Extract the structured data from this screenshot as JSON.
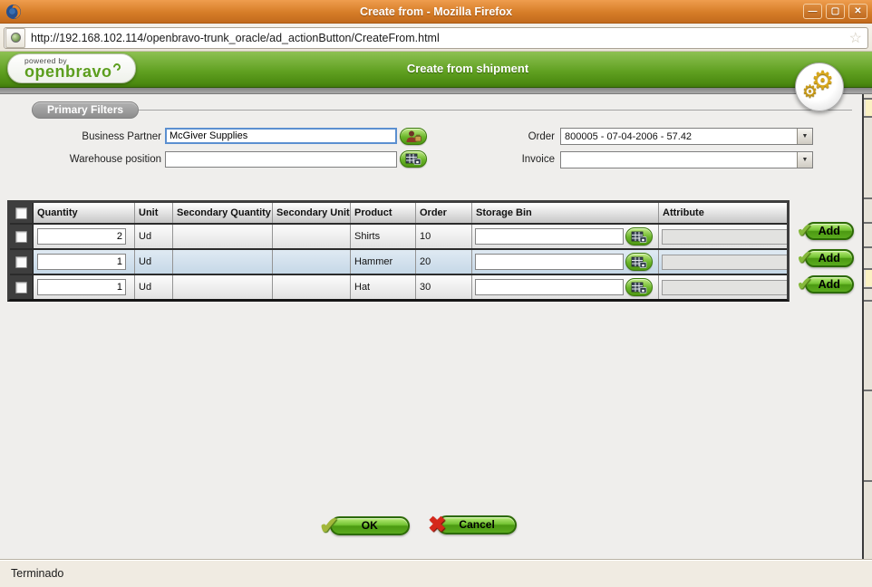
{
  "window": {
    "title": "Create from - Mozilla Firefox",
    "controls": {
      "minimize": "—",
      "maximize": "▢",
      "close": "✕"
    }
  },
  "browser": {
    "url": "http://192.168.102.114/openbravo-trunk_oracle/ad_actionButton/CreateFrom.html",
    "bookmark_star": "☆"
  },
  "header": {
    "powered_by": "powered by",
    "brand": "openbravo",
    "title": "Create from shipment"
  },
  "filters": {
    "section_label": "Primary Filters",
    "business_partner": {
      "label": "Business Partner",
      "value": "McGiver Supplies"
    },
    "warehouse_position": {
      "label": "Warehouse position",
      "value": ""
    },
    "order": {
      "label": "Order",
      "value": "800005 - 07-04-2006 - 57.42"
    },
    "invoice": {
      "label": "Invoice",
      "value": ""
    }
  },
  "grid": {
    "columns": [
      "Quantity",
      "Unit",
      "Secondary Quantity",
      "Secondary Unit",
      "Product",
      "Order",
      "Storage Bin",
      "Attribute"
    ],
    "rows": [
      {
        "quantity": "2",
        "unit": "Ud",
        "secondary_quantity": "",
        "secondary_unit": "",
        "product": "Shirts",
        "order": "10",
        "storage_bin": "",
        "attribute": ""
      },
      {
        "quantity": "1",
        "unit": "Ud",
        "secondary_quantity": "",
        "secondary_unit": "",
        "product": "Hammer",
        "order": "20",
        "storage_bin": "",
        "attribute": ""
      },
      {
        "quantity": "1",
        "unit": "Ud",
        "secondary_quantity": "",
        "secondary_unit": "",
        "product": "Hat",
        "order": "30",
        "storage_bin": "",
        "attribute": ""
      }
    ],
    "add_label": "Add"
  },
  "actions": {
    "ok": "OK",
    "cancel": "Cancel"
  },
  "statusbar": {
    "text": "Terminado"
  },
  "glyphs": {
    "check": "✔",
    "cross": "✖",
    "arrow": "▼",
    "gear": "⚙"
  },
  "colors": {
    "titlebar_orange": "#d67d28",
    "header_green": "#61a122",
    "brand_green": "#5c9e1e",
    "button_green": "#5aaa1e",
    "row_alt_blue": "#c6d8e7",
    "focus_blue": "#5b8fd0",
    "grid_border": "#3e3e3e"
  }
}
